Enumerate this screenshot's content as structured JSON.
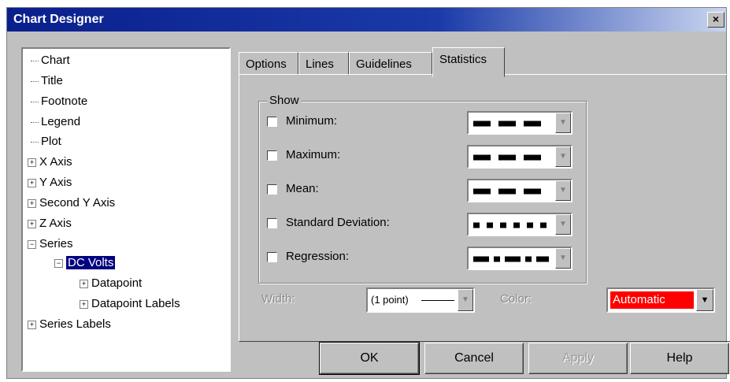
{
  "window": {
    "title": "Chart Designer",
    "close_label": "×"
  },
  "tree": {
    "items": [
      {
        "label": "Chart",
        "expander": ""
      },
      {
        "label": "Title",
        "expander": ""
      },
      {
        "label": "Footnote",
        "expander": ""
      },
      {
        "label": "Legend",
        "expander": ""
      },
      {
        "label": "Plot",
        "expander": ""
      },
      {
        "label": "X Axis",
        "expander": "+"
      },
      {
        "label": "Y Axis",
        "expander": "+"
      },
      {
        "label": "Second Y Axis",
        "expander": "+"
      },
      {
        "label": "Z Axis",
        "expander": "+"
      },
      {
        "label": "Series",
        "expander": "−"
      },
      {
        "label": "DC Volts",
        "expander": "−",
        "selected": true
      },
      {
        "label": "Datapoint",
        "expander": "+"
      },
      {
        "label": "Datapoint Labels",
        "expander": "+"
      },
      {
        "label": "Series Labels",
        "expander": "+"
      }
    ]
  },
  "tabs": [
    {
      "label": "Options"
    },
    {
      "label": "Lines"
    },
    {
      "label": "Guidelines"
    },
    {
      "label": "Statistics",
      "active": true
    }
  ],
  "show_group": {
    "label": "Show",
    "rows": [
      {
        "label": "Minimum:",
        "checked": false,
        "line_style": "dash"
      },
      {
        "label": "Maximum:",
        "checked": false,
        "line_style": "dash"
      },
      {
        "label": "Mean:",
        "checked": false,
        "line_style": "dash"
      },
      {
        "label": "Standard Deviation:",
        "checked": false,
        "line_style": "dot"
      },
      {
        "label": "Regression:",
        "checked": false,
        "line_style": "dashdot"
      }
    ]
  },
  "width": {
    "label": "Width:",
    "value": "(1 point)"
  },
  "color": {
    "label": "Color:",
    "value": "Automatic",
    "swatch": "#ff0000"
  },
  "buttons": {
    "ok": "OK",
    "cancel": "Cancel",
    "apply": "Apply",
    "help": "Help"
  }
}
